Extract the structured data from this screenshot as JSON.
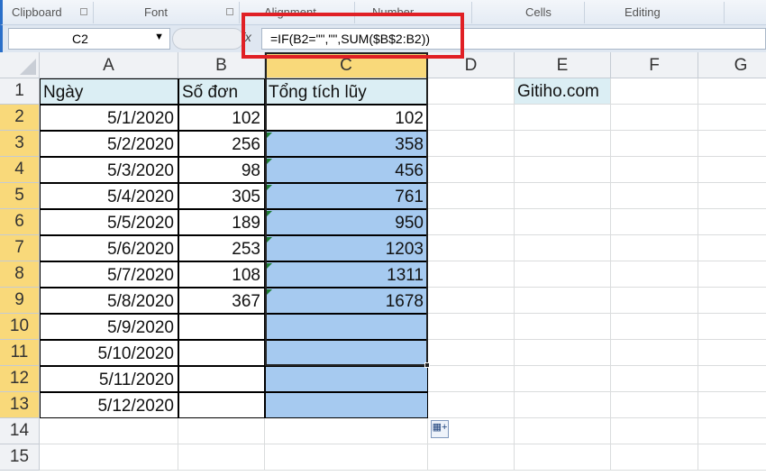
{
  "ribbon": {
    "groups": [
      "Clipboard",
      "Font",
      "Alignment",
      "Number",
      "Cells",
      "Editing"
    ]
  },
  "formula_bar": {
    "name_box": "C2",
    "fx_icon": "fx",
    "formula": "=IF(B2=\"\",\"\",SUM($B$2:B2))"
  },
  "columns": [
    "A",
    "B",
    "C",
    "D",
    "E",
    "F",
    "G"
  ],
  "rows": [
    "1",
    "2",
    "3",
    "4",
    "5",
    "6",
    "7",
    "8",
    "9",
    "10",
    "11",
    "12",
    "13",
    "14",
    "15"
  ],
  "header": {
    "a": "Ngày",
    "b": "Số đơn",
    "c": "Tổng tích lũy",
    "e": "Gitiho.com"
  },
  "data": [
    {
      "date": "5/1/2020",
      "orders": "102",
      "total": "102"
    },
    {
      "date": "5/2/2020",
      "orders": "256",
      "total": "358"
    },
    {
      "date": "5/3/2020",
      "orders": "98",
      "total": "456"
    },
    {
      "date": "5/4/2020",
      "orders": "305",
      "total": "761"
    },
    {
      "date": "5/5/2020",
      "orders": "189",
      "total": "950"
    },
    {
      "date": "5/6/2020",
      "orders": "253",
      "total": "1203"
    },
    {
      "date": "5/7/2020",
      "orders": "108",
      "total": "1311"
    },
    {
      "date": "5/8/2020",
      "orders": "367",
      "total": "1678"
    },
    {
      "date": "5/9/2020",
      "orders": "",
      "total": ""
    },
    {
      "date": "5/10/2020",
      "orders": "",
      "total": ""
    },
    {
      "date": "5/11/2020",
      "orders": "",
      "total": ""
    },
    {
      "date": "5/12/2020",
      "orders": "",
      "total": ""
    }
  ],
  "colors": {
    "selection": "#a6caf0",
    "header_fill": "#dbeef4",
    "highlight_box": "#e02025",
    "active_header": "#f9d97a"
  }
}
